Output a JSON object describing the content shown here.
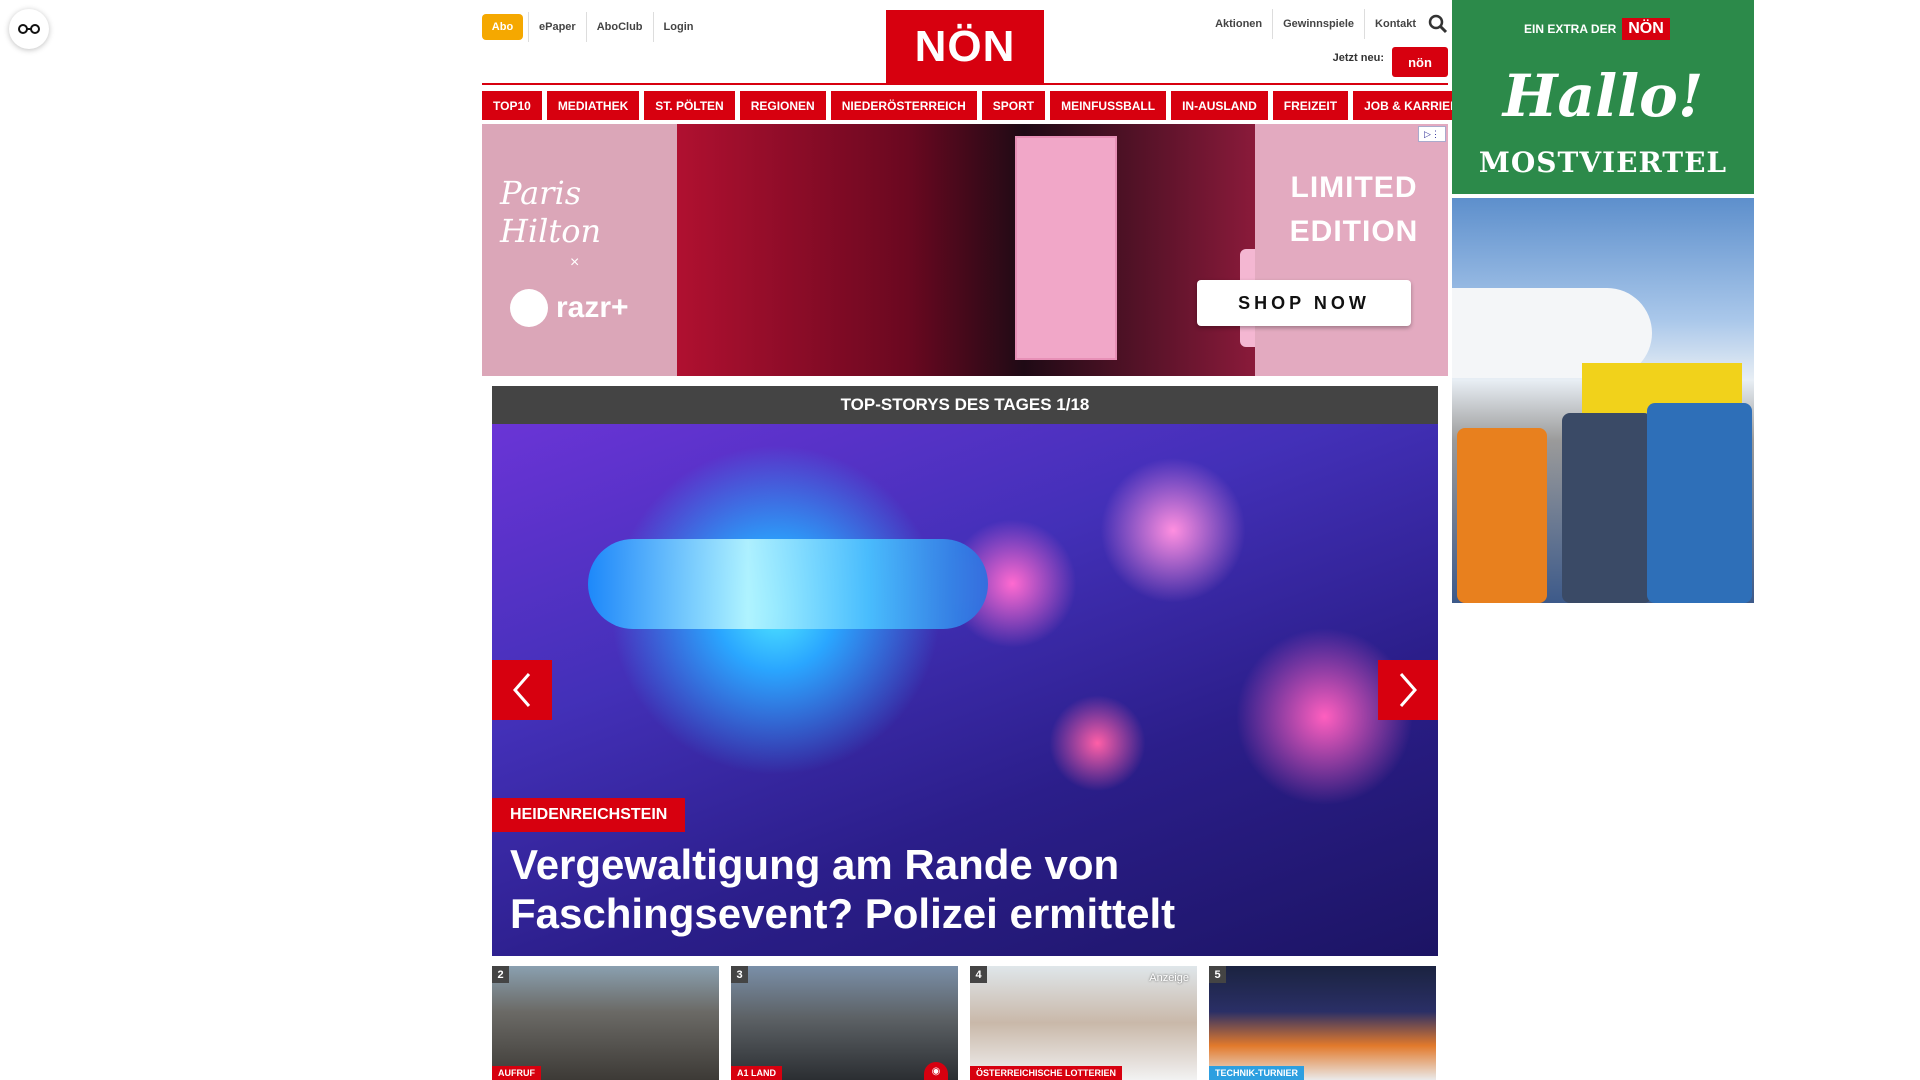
{
  "accessibility": {
    "icon": "glasses-icon"
  },
  "header": {
    "abo": "Abo",
    "left_links": [
      "ePaper",
      "AboClub",
      "Login"
    ],
    "right_links": [
      "Aktionen",
      "Gewinnspiele",
      "Kontakt"
    ],
    "logo": "NÖN",
    "jetzt_neu": "Jetzt neu:",
    "mini_logo": "nön",
    "search_icon": "search-icon"
  },
  "nav": [
    "TOP10",
    "MEDIATHEK",
    "ST. PÖLTEN",
    "REGIONEN",
    "NIEDERÖSTERREICH",
    "SPORT",
    "MEINFUSSBALL",
    "IN-AUSLAND",
    "FREIZEIT",
    "JOB & KARRIERE"
  ],
  "top_ad": {
    "brand": "Paris Hilton",
    "x": "×",
    "partner": "razr+",
    "limited": "LIMITED EDITION",
    "cta": "SHOP NOW"
  },
  "side_ad": {
    "extra": "EIN EXTRA DER",
    "brand": "NÖN",
    "hallo": "Hallo!",
    "region": "MOSTVIERTEL"
  },
  "stories": {
    "header": "TOP-STORYS DES TAGES 1/18",
    "hero_tag": "HEIDENREICHSTEIN",
    "hero_title": "Vergewaltigung am Rande von Faschingsevent? Polizei ermittelt",
    "thumbs": [
      {
        "num": "2",
        "tag": "AUFRUF"
      },
      {
        "num": "3",
        "tag": "A1 LAND"
      },
      {
        "num": "4",
        "tag": "ÖSTERREICHISCHE LOTTERIEN",
        "anzeige": "Anzeige"
      },
      {
        "num": "5",
        "tag": "TECHNIK-TURNIER"
      }
    ]
  },
  "colors": {
    "brand_red": "#d7000f",
    "abo_orange": "#f5a800",
    "story_header": "#444444",
    "side_green": "#2c8a4a"
  }
}
